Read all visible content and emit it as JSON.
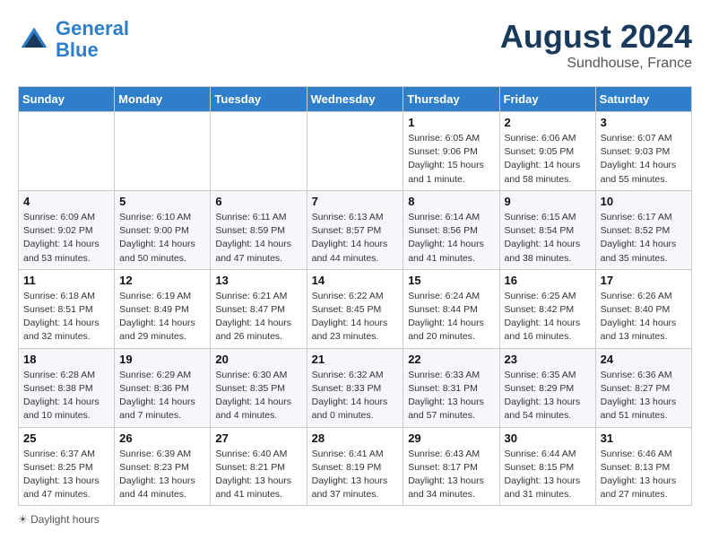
{
  "header": {
    "logo_line1": "General",
    "logo_line2": "Blue",
    "month": "August 2024",
    "location": "Sundhouse, France"
  },
  "days_of_week": [
    "Sunday",
    "Monday",
    "Tuesday",
    "Wednesday",
    "Thursday",
    "Friday",
    "Saturday"
  ],
  "weeks": [
    [
      {
        "num": "",
        "info": ""
      },
      {
        "num": "",
        "info": ""
      },
      {
        "num": "",
        "info": ""
      },
      {
        "num": "",
        "info": ""
      },
      {
        "num": "1",
        "info": "Sunrise: 6:05 AM\nSunset: 9:06 PM\nDaylight: 15 hours and 1 minute."
      },
      {
        "num": "2",
        "info": "Sunrise: 6:06 AM\nSunset: 9:05 PM\nDaylight: 14 hours and 58 minutes."
      },
      {
        "num": "3",
        "info": "Sunrise: 6:07 AM\nSunset: 9:03 PM\nDaylight: 14 hours and 55 minutes."
      }
    ],
    [
      {
        "num": "4",
        "info": "Sunrise: 6:09 AM\nSunset: 9:02 PM\nDaylight: 14 hours and 53 minutes."
      },
      {
        "num": "5",
        "info": "Sunrise: 6:10 AM\nSunset: 9:00 PM\nDaylight: 14 hours and 50 minutes."
      },
      {
        "num": "6",
        "info": "Sunrise: 6:11 AM\nSunset: 8:59 PM\nDaylight: 14 hours and 47 minutes."
      },
      {
        "num": "7",
        "info": "Sunrise: 6:13 AM\nSunset: 8:57 PM\nDaylight: 14 hours and 44 minutes."
      },
      {
        "num": "8",
        "info": "Sunrise: 6:14 AM\nSunset: 8:56 PM\nDaylight: 14 hours and 41 minutes."
      },
      {
        "num": "9",
        "info": "Sunrise: 6:15 AM\nSunset: 8:54 PM\nDaylight: 14 hours and 38 minutes."
      },
      {
        "num": "10",
        "info": "Sunrise: 6:17 AM\nSunset: 8:52 PM\nDaylight: 14 hours and 35 minutes."
      }
    ],
    [
      {
        "num": "11",
        "info": "Sunrise: 6:18 AM\nSunset: 8:51 PM\nDaylight: 14 hours and 32 minutes."
      },
      {
        "num": "12",
        "info": "Sunrise: 6:19 AM\nSunset: 8:49 PM\nDaylight: 14 hours and 29 minutes."
      },
      {
        "num": "13",
        "info": "Sunrise: 6:21 AM\nSunset: 8:47 PM\nDaylight: 14 hours and 26 minutes."
      },
      {
        "num": "14",
        "info": "Sunrise: 6:22 AM\nSunset: 8:45 PM\nDaylight: 14 hours and 23 minutes."
      },
      {
        "num": "15",
        "info": "Sunrise: 6:24 AM\nSunset: 8:44 PM\nDaylight: 14 hours and 20 minutes."
      },
      {
        "num": "16",
        "info": "Sunrise: 6:25 AM\nSunset: 8:42 PM\nDaylight: 14 hours and 16 minutes."
      },
      {
        "num": "17",
        "info": "Sunrise: 6:26 AM\nSunset: 8:40 PM\nDaylight: 14 hours and 13 minutes."
      }
    ],
    [
      {
        "num": "18",
        "info": "Sunrise: 6:28 AM\nSunset: 8:38 PM\nDaylight: 14 hours and 10 minutes."
      },
      {
        "num": "19",
        "info": "Sunrise: 6:29 AM\nSunset: 8:36 PM\nDaylight: 14 hours and 7 minutes."
      },
      {
        "num": "20",
        "info": "Sunrise: 6:30 AM\nSunset: 8:35 PM\nDaylight: 14 hours and 4 minutes."
      },
      {
        "num": "21",
        "info": "Sunrise: 6:32 AM\nSunset: 8:33 PM\nDaylight: 14 hours and 0 minutes."
      },
      {
        "num": "22",
        "info": "Sunrise: 6:33 AM\nSunset: 8:31 PM\nDaylight: 13 hours and 57 minutes."
      },
      {
        "num": "23",
        "info": "Sunrise: 6:35 AM\nSunset: 8:29 PM\nDaylight: 13 hours and 54 minutes."
      },
      {
        "num": "24",
        "info": "Sunrise: 6:36 AM\nSunset: 8:27 PM\nDaylight: 13 hours and 51 minutes."
      }
    ],
    [
      {
        "num": "25",
        "info": "Sunrise: 6:37 AM\nSunset: 8:25 PM\nDaylight: 13 hours and 47 minutes."
      },
      {
        "num": "26",
        "info": "Sunrise: 6:39 AM\nSunset: 8:23 PM\nDaylight: 13 hours and 44 minutes."
      },
      {
        "num": "27",
        "info": "Sunrise: 6:40 AM\nSunset: 8:21 PM\nDaylight: 13 hours and 41 minutes."
      },
      {
        "num": "28",
        "info": "Sunrise: 6:41 AM\nSunset: 8:19 PM\nDaylight: 13 hours and 37 minutes."
      },
      {
        "num": "29",
        "info": "Sunrise: 6:43 AM\nSunset: 8:17 PM\nDaylight: 13 hours and 34 minutes."
      },
      {
        "num": "30",
        "info": "Sunrise: 6:44 AM\nSunset: 8:15 PM\nDaylight: 13 hours and 31 minutes."
      },
      {
        "num": "31",
        "info": "Sunrise: 6:46 AM\nSunset: 8:13 PM\nDaylight: 13 hours and 27 minutes."
      }
    ]
  ],
  "footer": {
    "note": "Daylight hours"
  }
}
